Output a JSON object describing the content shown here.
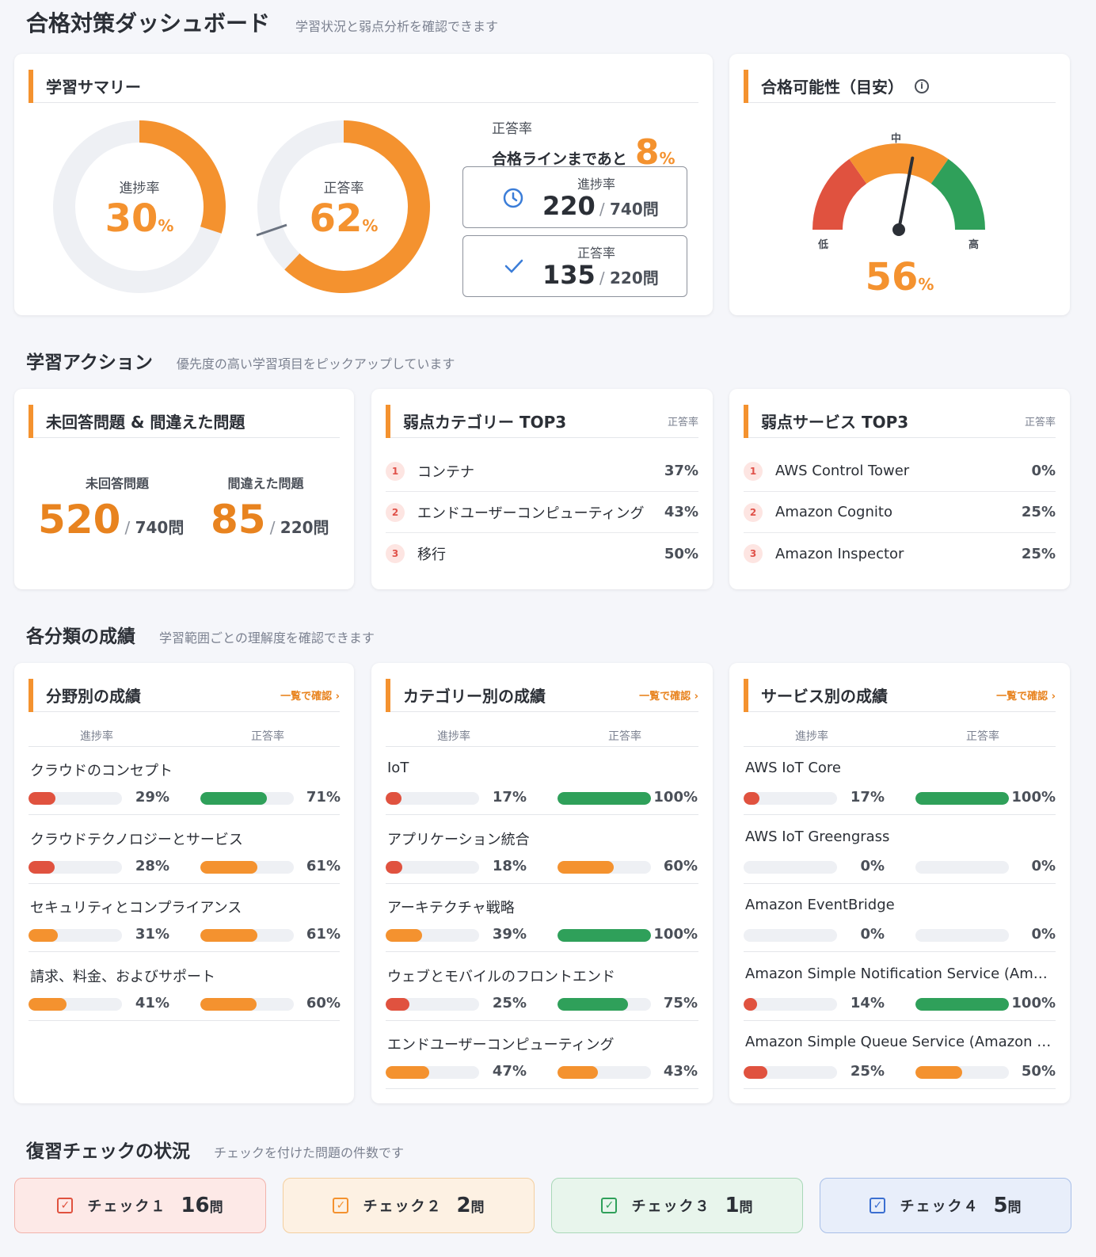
{
  "header": {
    "title": "合格対策ダッシュボード",
    "subtitle": "学習状況と弱点分析を確認できます"
  },
  "summary": {
    "title": "学習サマリー",
    "progress": {
      "label": "進捗率",
      "value": 30,
      "unit": "%"
    },
    "accuracy": {
      "label": "正答率",
      "value": 62,
      "unit": "%"
    },
    "remain": {
      "line1": "正答率",
      "line2": "合格ラインまであと",
      "value": "8",
      "unit": "%"
    },
    "box_progress": {
      "label": "進捗率",
      "value": "220",
      "total": "740問"
    },
    "box_accuracy": {
      "label": "正答率",
      "value": "135",
      "total": "220問"
    }
  },
  "pass": {
    "title": "合格可能性（目安）",
    "low": "低",
    "mid": "中",
    "high": "高",
    "value": 56,
    "unit": "%",
    "colors": {
      "low": "#e0523f",
      "mid": "#f4922f",
      "high": "#2fa05a"
    }
  },
  "actions": {
    "title": "学習アクション",
    "subtitle": "優先度の高い学習項目をピックアップしています"
  },
  "unanswered": {
    "title": "未回答問題 & 間違えた問題",
    "left": {
      "label": "未回答問題",
      "value": "520",
      "total": "740問"
    },
    "right": {
      "label": "間違えた問題",
      "value": "85",
      "total": "220問"
    }
  },
  "weak_category": {
    "title": "弱点カテゴリー TOP3",
    "right": "正答率",
    "items": [
      {
        "rank": "1",
        "name": "コンテナ",
        "pct": "37%"
      },
      {
        "rank": "2",
        "name": "エンドユーザーコンピューティング",
        "pct": "43%"
      },
      {
        "rank": "3",
        "name": "移行",
        "pct": "50%"
      }
    ]
  },
  "weak_service": {
    "title": "弱点サービス TOP3",
    "right": "正答率",
    "items": [
      {
        "rank": "1",
        "name": "AWS Control Tower",
        "pct": "0%"
      },
      {
        "rank": "2",
        "name": "Amazon Cognito",
        "pct": "25%"
      },
      {
        "rank": "3",
        "name": "Amazon Inspector",
        "pct": "25%"
      }
    ]
  },
  "results": {
    "title": "各分類の成績",
    "subtitle": "学習範囲ごとの理解度を確認できます"
  },
  "perf_labels": {
    "progress": "進捗率",
    "accuracy": "正答率",
    "link": "一覧で確認 ›"
  },
  "perf_field": {
    "title": "分野別の成績",
    "items": [
      {
        "name": "クラウドのコンセプト",
        "p": 29,
        "a": 71
      },
      {
        "name": "クラウドテクノロジーとサービス",
        "p": 28,
        "a": 61
      },
      {
        "name": "セキュリティとコンプライアンス",
        "p": 31,
        "a": 61
      },
      {
        "name": "請求、料金、およびサポート",
        "p": 41,
        "a": 60
      }
    ]
  },
  "perf_category": {
    "title": "カテゴリー別の成績",
    "items": [
      {
        "name": "IoT",
        "p": 17,
        "a": 100
      },
      {
        "name": "アプリケーション統合",
        "p": 18,
        "a": 60
      },
      {
        "name": "アーキテクチャ戦略",
        "p": 39,
        "a": 100
      },
      {
        "name": "ウェブとモバイルのフロントエンド",
        "p": 25,
        "a": 75
      },
      {
        "name": "エンドユーザーコンピューティング",
        "p": 47,
        "a": 43
      }
    ]
  },
  "perf_service": {
    "title": "サービス別の成績",
    "items": [
      {
        "name": "AWS IoT Core",
        "p": 17,
        "a": 100
      },
      {
        "name": "AWS IoT Greengrass",
        "p": 0,
        "a": 0
      },
      {
        "name": "Amazon EventBridge",
        "p": 0,
        "a": 0
      },
      {
        "name": "Amazon Simple Notification Service (Amazon SNS)",
        "p": 14,
        "a": 100
      },
      {
        "name": "Amazon Simple Queue Service (Amazon SQS)",
        "p": 25,
        "a": 50
      }
    ]
  },
  "bar_colors": {
    "red": "#e0523f",
    "orange": "#f4922f",
    "green": "#2fa05a"
  },
  "review": {
    "title": "復習チェックの状況",
    "subtitle": "チェックを付けた問題の件数です",
    "unit": "問",
    "items": [
      {
        "label": "チェック１",
        "count": "16",
        "bg": "#fde9e7",
        "border": "#f2b3ab",
        "color": "#e0523f"
      },
      {
        "label": "チェック２",
        "count": "2",
        "bg": "#fdf1e3",
        "border": "#f4cf9f",
        "color": "#f4922f"
      },
      {
        "label": "チェック３",
        "count": "1",
        "bg": "#e8f5ec",
        "border": "#a9d8b8",
        "color": "#2fa05a"
      },
      {
        "label": "チェック４",
        "count": "5",
        "bg": "#e8eefa",
        "border": "#a8bfe8",
        "color": "#3b6fd1"
      }
    ]
  }
}
